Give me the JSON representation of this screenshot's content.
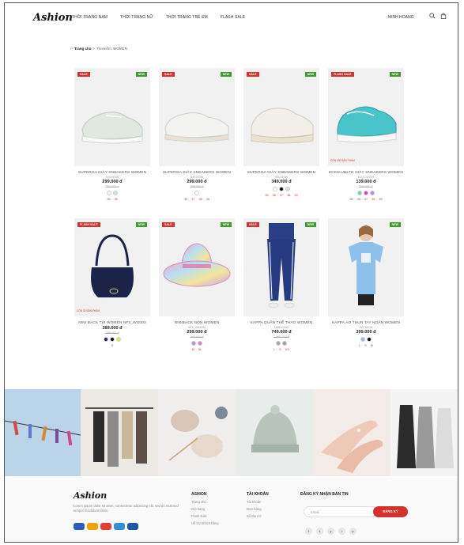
{
  "header": {
    "logo": "Ashion",
    "nav": [
      "THỜI TRANG NAM",
      "THỜI TRANG NỮ",
      "THỜI TRANG TRẺ EM",
      "FLASH SALE"
    ],
    "user": "MINH HOANG",
    "icons": [
      "search-icon",
      "bag-icon"
    ]
  },
  "breadcrumb": {
    "home": "Trang chủ",
    "sep": ">",
    "current": "Tìm kiếm: WOMEN"
  },
  "products": [
    {
      "left_tag": "SALE",
      "right_tag": "NEW",
      "promo": "",
      "name": "SUPERGA GIÀY SNEAKERS WOMEN",
      "sku": "S4019SW",
      "price": "299.000 đ",
      "old": "399.000 đ",
      "swatches": [
        "#ffffff",
        "#cfead9"
      ],
      "sizes": [
        "35",
        "36"
      ]
    },
    {
      "left_tag": "SALE",
      "right_tag": "NEW",
      "promo": "",
      "name": "SUPERGA GIÀY SNEAKERS WOMEN",
      "sku": "S4019SW",
      "price": "299.000 đ",
      "old": "399.000 đ",
      "swatches": [
        "#ffffff"
      ],
      "sizes": [
        "36",
        "37",
        "38",
        "39"
      ]
    },
    {
      "left_tag": "SALE",
      "right_tag": "NEW",
      "promo": "",
      "name": "SUPERGA GIÀY SNEAKERS WOMEN",
      "sku": "S4019SW",
      "price": "349.000 đ",
      "old": "",
      "swatches": [
        "#ffffff",
        "#111111",
        "#dddddd"
      ],
      "sizes": [
        "35",
        "36",
        "37",
        "38",
        "39"
      ]
    },
    {
      "left_tag": "FLASH SALE",
      "right_tag": "NEW",
      "promo": "CÓN 130 SẢN PHẨM",
      "name": "ECKO UNLTD GIÀY SNEAKERS WOMEN",
      "sku": "EU21-WS09",
      "price": "139.000 đ",
      "old": "239.000 đ",
      "swatches": [
        "#6fd3c6",
        "#d93bd0",
        "#b98be6"
      ],
      "sizes": [
        "35",
        "36",
        "37",
        "38",
        "39"
      ]
    },
    {
      "left_tag": "FLASH SALE",
      "right_tag": "NEW",
      "promo": "CÓN 30 SẢN PHẨM",
      "name": "NINI BACK TÚI WOMEN NF3_WG002",
      "sku": "",
      "price": "389.000 đ",
      "old": "599.000 đ",
      "swatches": [
        "#1a2a5a",
        "#111111",
        "#e8e83a"
      ],
      "sizes": [
        "S"
      ]
    },
    {
      "left_tag": "SALE",
      "right_tag": "NEW",
      "promo": "",
      "name": "NINIBACK NÓN WOMEN",
      "sku": "NF3_WA5006",
      "price": "299.000 đ",
      "old": "399.000 đ",
      "swatches": [
        "#b98be6",
        "#e47ad8"
      ],
      "sizes": [
        "M",
        "XL"
      ]
    },
    {
      "left_tag": "SALE",
      "right_tag": "NEW",
      "promo": "",
      "name": "KAPPA QUẦN THỂ THAO WOMEN",
      "sku": "3W61130W",
      "price": "749.000 đ",
      "old": "1.499.000 đ",
      "swatches": [
        "#9aa6c2",
        "#a0a0a0"
      ],
      "sizes": [
        "L",
        "S",
        "XS"
      ]
    },
    {
      "left_tag": "",
      "right_tag": "NEW",
      "promo": "",
      "name": "KAPPA ÁO THUN TAY NGẮN WOMEN",
      "sku": "3W7801W",
      "price": "399.000 đ",
      "old": "",
      "swatches": [
        "#9fbfe8",
        "#111111"
      ],
      "sizes": [
        "L",
        "S",
        "M"
      ]
    }
  ],
  "footer": {
    "logo": "Ashion",
    "desc": "Lorem ipsum dolor sit amet, consectetur adipiscing elit, sed do eiusmod tempor incididunt cilisis.",
    "col1": {
      "title": "ASHION",
      "links": [
        "Trang chủ",
        "Giỏ hàng",
        "Flash Sale",
        "Hỗ trợ khách hàng"
      ]
    },
    "col2": {
      "title": "TÀI KHOẢN",
      "links": [
        "Tài khoản",
        "Đơn hàng",
        "Sổ địa chỉ"
      ]
    },
    "newsletter": {
      "title": "ĐĂNG KÝ NHẬN BẢN TIN",
      "placeholder": "Email",
      "button": "ĐĂNG KÝ"
    },
    "socials": [
      "f",
      "t",
      "y",
      "i",
      "p"
    ],
    "payments": [
      "#2b5db8",
      "#f2a200",
      "#e93c2f",
      "#2f8fd8",
      "#1b59a6"
    ]
  },
  "colors": {
    "accent": "#d5302a",
    "new": "#3c9c2a"
  }
}
